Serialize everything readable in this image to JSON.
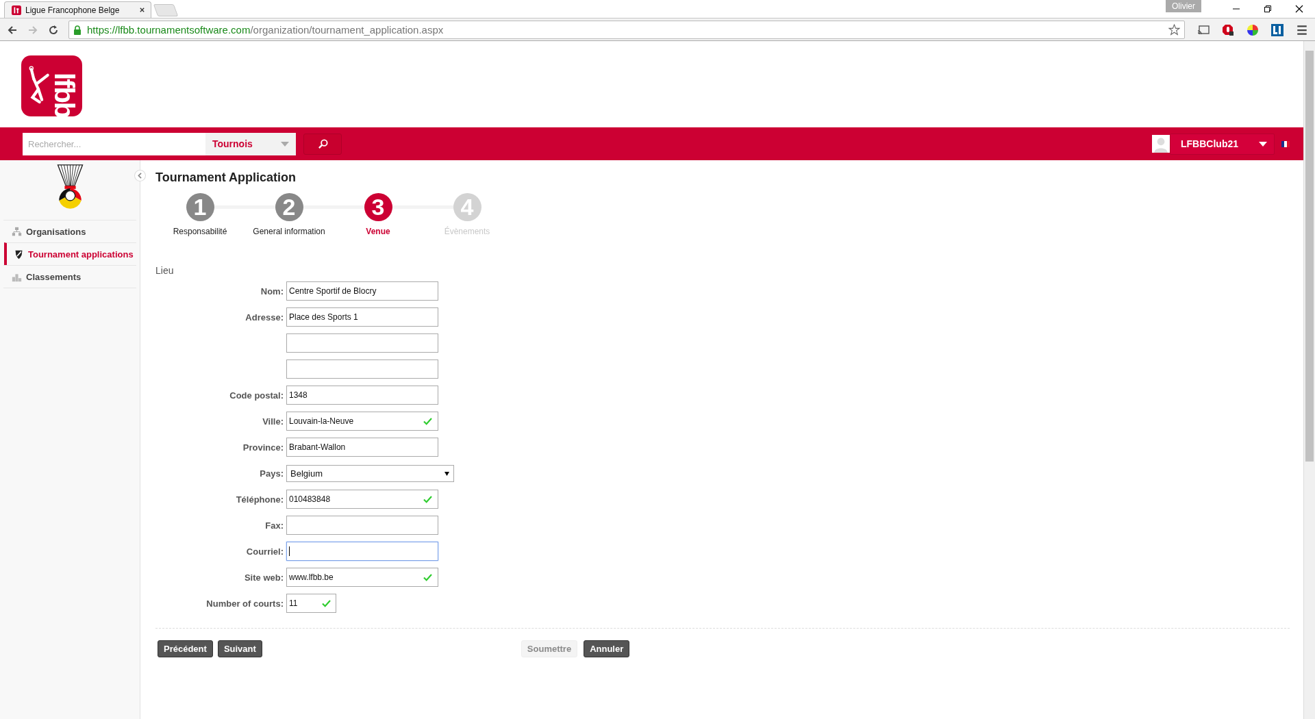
{
  "browser": {
    "tab_title": "Ligue Francophone Belge",
    "url_host": "https://lfbb.tournamentsoftware.com",
    "url_path": "/organization/tournament_application.aspx",
    "profile": "Olivier"
  },
  "header": {
    "logo_text": "lfbb",
    "search_placeholder": "Rechercher...",
    "search_scope": "Tournois",
    "user": "LFBBClub21"
  },
  "sidebar": {
    "items": [
      {
        "label": "Organisations",
        "kind": "organisations",
        "selected": false
      },
      {
        "label": "Tournament applications",
        "kind": "applications",
        "selected": true
      },
      {
        "label": "Classements",
        "kind": "rankings",
        "selected": false
      }
    ]
  },
  "page_title": "Tournament Application",
  "steps": [
    {
      "number": "1",
      "label": "Responsabilité",
      "selected": false,
      "disabled": false
    },
    {
      "number": "2",
      "label": "General information",
      "selected": false,
      "disabled": false
    },
    {
      "number": "3",
      "label": "Venue",
      "selected": true,
      "disabled": false
    },
    {
      "number": "4",
      "label": "Évènements",
      "selected": false,
      "disabled": true
    }
  ],
  "section_title": "Lieu",
  "fields": [
    {
      "label": "Nom:",
      "kind": "text",
      "value": "Centre Sportif de Blocry",
      "valid": false,
      "focused": false
    },
    {
      "label": "Adresse:",
      "kind": "text",
      "value": "Place des Sports 1",
      "valid": false,
      "focused": false
    },
    {
      "kind": "text",
      "valid": false,
      "focused": false
    },
    {
      "kind": "text",
      "valid": false,
      "focused": false
    },
    {
      "label": "Code postal:",
      "kind": "text",
      "value": "1348",
      "valid": false,
      "focused": false
    },
    {
      "label": "Ville:",
      "kind": "text",
      "value": "Louvain-la-Neuve",
      "valid": true,
      "focused": false
    },
    {
      "label": "Province:",
      "kind": "text",
      "value": "Brabant-Wallon",
      "valid": false,
      "focused": false
    },
    {
      "label": "Pays:",
      "kind": "select",
      "value": "Belgium",
      "valid": false,
      "focused": false
    },
    {
      "label": "Téléphone:",
      "kind": "text",
      "value": "010483848",
      "valid": true,
      "focused": false
    },
    {
      "label": "Fax:",
      "kind": "text",
      "valid": false,
      "focused": false
    },
    {
      "label": "Courriel:",
      "kind": "text",
      "valid": false,
      "focused": true
    },
    {
      "label": "Site web:",
      "kind": "text",
      "value": "www.lfbb.be",
      "valid": true,
      "focused": false
    },
    {
      "label": "Number of courts:",
      "kind": "number",
      "value": "11",
      "valid": true,
      "focused": false
    }
  ],
  "buttons_left": [
    {
      "label": "Précédent",
      "disabled": false
    },
    {
      "label": "Suivant",
      "disabled": false
    }
  ],
  "buttons_right": [
    {
      "label": "Soumettre",
      "disabled": true
    },
    {
      "label": "Annuler",
      "disabled": false
    }
  ]
}
